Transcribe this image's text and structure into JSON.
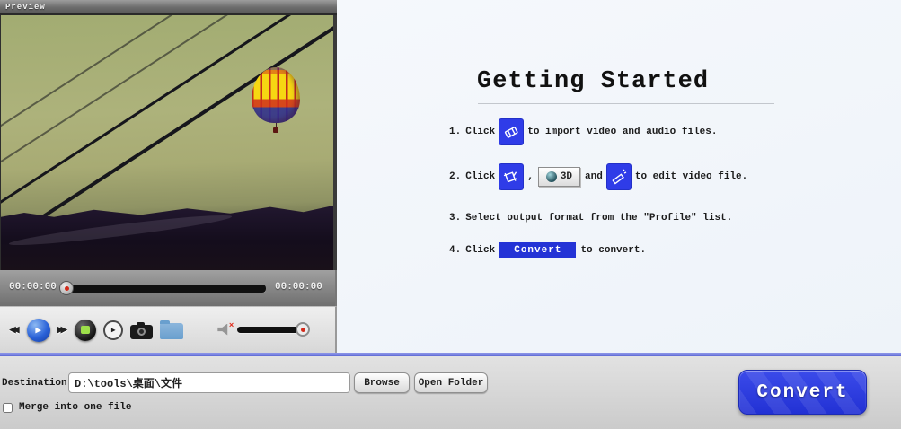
{
  "preview": {
    "title": "Preview",
    "current_time": "00:00:00",
    "total_time": "00:00:00",
    "controls": {
      "rewind_glyph": "◀◀",
      "play_glyph": "▶",
      "forward_glyph": "▶▶",
      "step_glyph": "▶",
      "mute_glyph": "×"
    }
  },
  "getting_started": {
    "title": "Getting Started",
    "steps": {
      "s1": {
        "num": "1.",
        "click": "Click",
        "rest": "to import video and audio files."
      },
      "s2": {
        "num": "2.",
        "click": "Click",
        "comma": ",",
        "btn3d": "3D",
        "and": "and",
        "rest": "to edit video file."
      },
      "s3": {
        "num": "3.",
        "text": "Select output format from the \"Profile\" list."
      },
      "s4": {
        "num": "4.",
        "click": "Click",
        "convert": "Convert",
        "rest": "to convert."
      }
    }
  },
  "bottom": {
    "destination_label": "Destination:",
    "destination_value": "D:\\tools\\桌面\\文件",
    "browse": "Browse",
    "open_folder": "Open Folder",
    "merge_label": "Merge into one file",
    "merge_checked": false,
    "convert": "Convert"
  },
  "colors": {
    "accent_blue": "#2f3ce8",
    "separator_blue": "#6f7ade",
    "panel_bg": "#f3f6fa",
    "convert_button": "#2a38dd"
  }
}
